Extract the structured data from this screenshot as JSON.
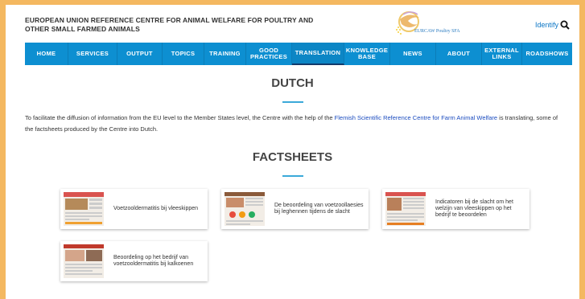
{
  "header": {
    "site_title": "EUROPEAN UNION REFERENCE CENTRE FOR ANIMAL WELFARE FOR POULTRY AND OTHER SMALL FARMED ANIMALS",
    "logo_text": "EURCAW Poultry SFA",
    "identify_label": "Identify"
  },
  "nav": {
    "items": [
      {
        "label": "HOME"
      },
      {
        "label": "SERVICES"
      },
      {
        "label": "OUTPUT"
      },
      {
        "label": "TOPICS"
      },
      {
        "label": "TRAINING"
      },
      {
        "label": "GOOD PRACTICES"
      },
      {
        "label": "TRANSLATION"
      },
      {
        "label": "KNOWLEDGE BASE"
      },
      {
        "label": "NEWS"
      },
      {
        "label": "ABOUT"
      },
      {
        "label": "EXTERNAL LINKS"
      },
      {
        "label": "ROADSHOWS"
      }
    ],
    "active": "TRANSLATION"
  },
  "main": {
    "heading": "DUTCH",
    "intro_before": "To facilitate the diffusion of information from the EU level to the Member States level, the Centre with the help of the ",
    "intro_link": "Flemish Scientific Reference Centre for Farm Animal Welfare",
    "intro_after": " is translating, some of the factsheets produced by the Centre into Dutch.",
    "factsheets_heading": "FACTSHEETS",
    "factsheets": [
      {
        "title": "Voetzooldermatitis bij vleeskippen"
      },
      {
        "title": "De beoordeling van voetzoollaesies bij leghennen tijdens de slacht"
      },
      {
        "title": "Indicatoren bij de slacht om het welzijn van vleeskippen op het bedrijf te beoordelen"
      },
      {
        "title": "Beoordeling op het bedrijf van voetzooldermatitis bij kalkoenen"
      }
    ]
  },
  "colors": {
    "nav": "#0d8fd1",
    "frame": "#f4b860",
    "accent_rule": "#3ba9d9",
    "link": "#1a4bbf"
  }
}
